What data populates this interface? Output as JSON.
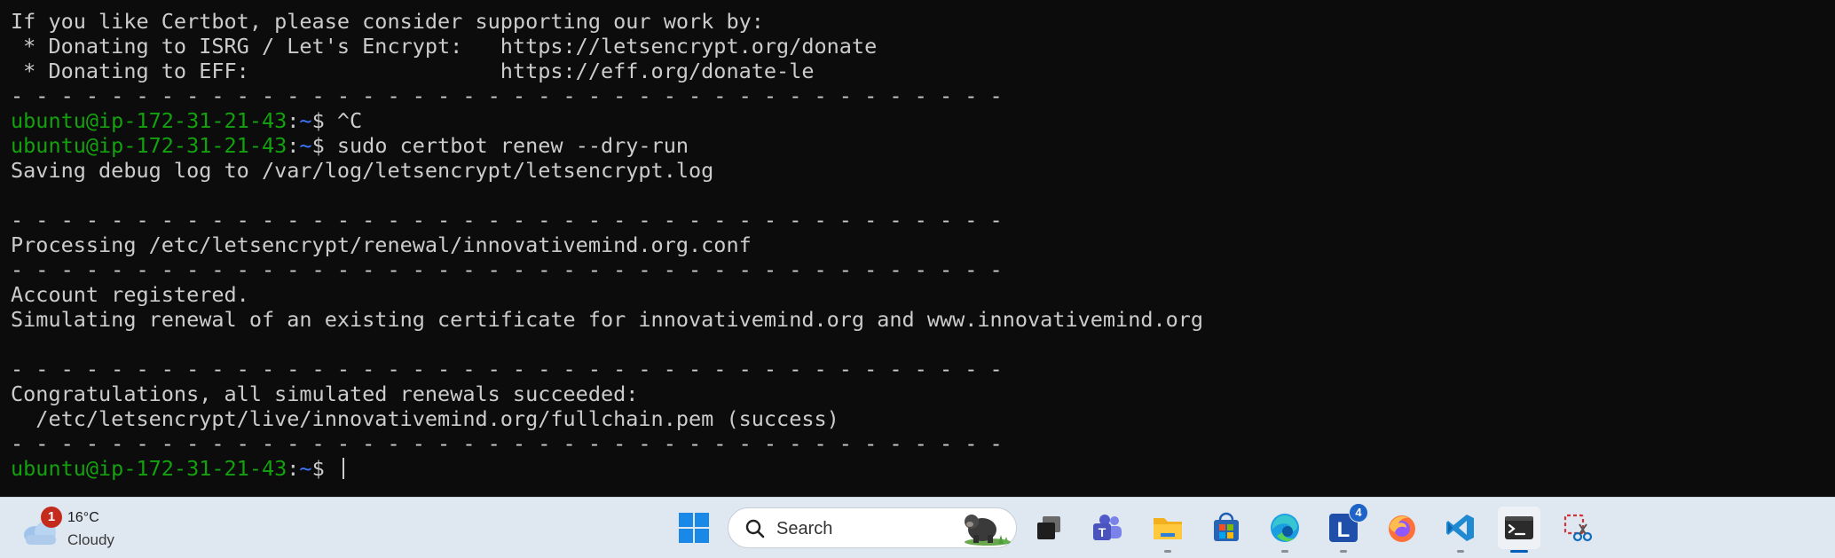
{
  "terminal": {
    "lines": [
      {
        "kind": "text",
        "text": "- - - - - - - - - - - - - - - - - - - - - - - - - - - - - - - - - - - - - - - -"
      },
      {
        "kind": "text",
        "text": "If you like Certbot, please consider supporting our work by:"
      },
      {
        "kind": "text",
        "text": " * Donating to ISRG / Let's Encrypt:   https://letsencrypt.org/donate"
      },
      {
        "kind": "text",
        "text": " * Donating to EFF:                    https://eff.org/donate-le"
      },
      {
        "kind": "text",
        "text": "- - - - - - - - - - - - - - - - - - - - - - - - - - - - - - - - - - - - - - - -"
      },
      {
        "kind": "prompt",
        "user": "ubuntu@ip-172-31-21-43",
        "sep": ":",
        "path": "~",
        "symbol": "$ ",
        "cmd": "^C"
      },
      {
        "kind": "prompt",
        "user": "ubuntu@ip-172-31-21-43",
        "sep": ":",
        "path": "~",
        "symbol": "$ ",
        "cmd": "sudo certbot renew --dry-run"
      },
      {
        "kind": "text",
        "text": "Saving debug log to /var/log/letsencrypt/letsencrypt.log"
      },
      {
        "kind": "text",
        "text": ""
      },
      {
        "kind": "text",
        "text": "- - - - - - - - - - - - - - - - - - - - - - - - - - - - - - - - - - - - - - - -"
      },
      {
        "kind": "text",
        "text": "Processing /etc/letsencrypt/renewal/innovativemind.org.conf"
      },
      {
        "kind": "text",
        "text": "- - - - - - - - - - - - - - - - - - - - - - - - - - - - - - - - - - - - - - - -"
      },
      {
        "kind": "text",
        "text": "Account registered."
      },
      {
        "kind": "text",
        "text": "Simulating renewal of an existing certificate for innovativemind.org and www.innovativemind.org"
      },
      {
        "kind": "text",
        "text": ""
      },
      {
        "kind": "text",
        "text": "- - - - - - - - - - - - - - - - - - - - - - - - - - - - - - - - - - - - - - - -"
      },
      {
        "kind": "text",
        "text": "Congratulations, all simulated renewals succeeded:"
      },
      {
        "kind": "text",
        "text": "  /etc/letsencrypt/live/innovativemind.org/fullchain.pem (success)"
      },
      {
        "kind": "text",
        "text": "- - - - - - - - - - - - - - - - - - - - - - - - - - - - - - - - - - - - - - - -"
      },
      {
        "kind": "prompt",
        "user": "ubuntu@ip-172-31-21-43",
        "sep": ":",
        "path": "~",
        "symbol": "$ ",
        "cmd": "",
        "cursor": true
      }
    ],
    "colors": {
      "background": "#0c0c0c",
      "foreground": "#cccccc",
      "prompt_user": "#13a10e",
      "prompt_path": "#3b78ff"
    }
  },
  "taskbar": {
    "weather": {
      "icon": "cloudy-weather-icon",
      "badge": "1",
      "temperature": "16°C",
      "condition": "Cloudy"
    },
    "search": {
      "label": "Search",
      "icon": "search-icon"
    },
    "apps": [
      {
        "name": "start-button",
        "icon": "windows-logo-icon",
        "running": false
      },
      {
        "name": "task-view-button",
        "icon": "task-view-icon",
        "running": false
      },
      {
        "name": "teams-button",
        "icon": "teams-icon",
        "running": false
      },
      {
        "name": "file-explorer-button",
        "icon": "folder-icon",
        "running": true
      },
      {
        "name": "microsoft-store-button",
        "icon": "store-icon",
        "running": false
      },
      {
        "name": "edge-button",
        "icon": "edge-icon",
        "running": true
      },
      {
        "name": "app-l-button",
        "icon": "l-app-icon",
        "running": true,
        "badge": "4"
      },
      {
        "name": "firefox-button",
        "icon": "firefox-icon",
        "running": false
      },
      {
        "name": "vscode-button",
        "icon": "vscode-icon",
        "running": true
      },
      {
        "name": "terminal-button",
        "icon": "terminal-icon",
        "running": true,
        "active": true
      },
      {
        "name": "snipping-tool-button",
        "icon": "snipping-tool-icon",
        "running": false
      }
    ]
  }
}
